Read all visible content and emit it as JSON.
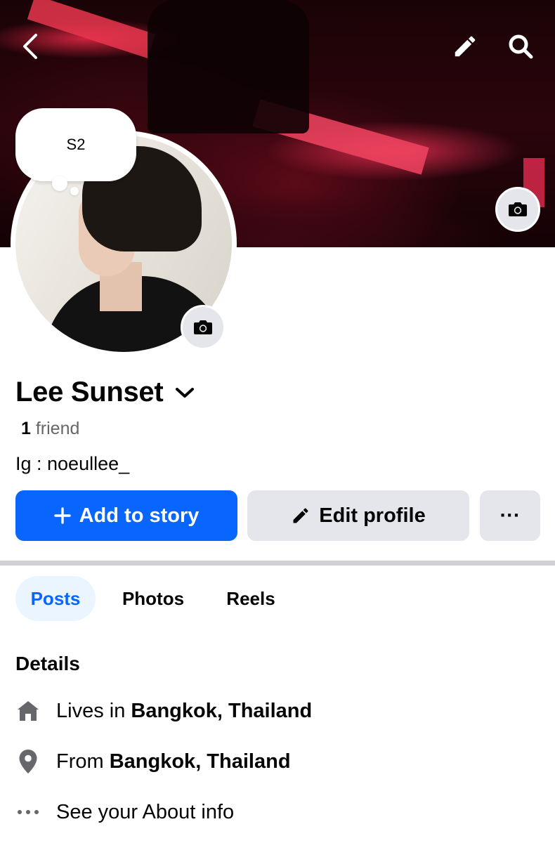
{
  "header": {
    "back_icon": "chevron-left-icon",
    "edit_icon": "pencil-icon",
    "search_icon": "search-icon"
  },
  "note": {
    "text": "S2"
  },
  "profile": {
    "name": "Lee Sunset",
    "friends_count": "1",
    "friends_label": "friend",
    "bio": "Ig : noeullee_"
  },
  "actions": {
    "add_story_label": "Add to story",
    "edit_profile_label": "Edit profile",
    "more_label": "···"
  },
  "tabs": [
    {
      "label": "Posts",
      "active": true
    },
    {
      "label": "Photos",
      "active": false
    },
    {
      "label": "Reels",
      "active": false
    }
  ],
  "details": {
    "title": "Details",
    "lives_prefix": "Lives in ",
    "lives_place": "Bangkok, Thailand",
    "from_prefix": "From ",
    "from_place": "Bangkok, Thailand",
    "about_label": "See your About info"
  },
  "colors": {
    "accent": "#0866ff",
    "button_gray": "#e4e6eb",
    "active_tab_bg": "#ebf5ff",
    "secondary_text": "#65676b"
  }
}
